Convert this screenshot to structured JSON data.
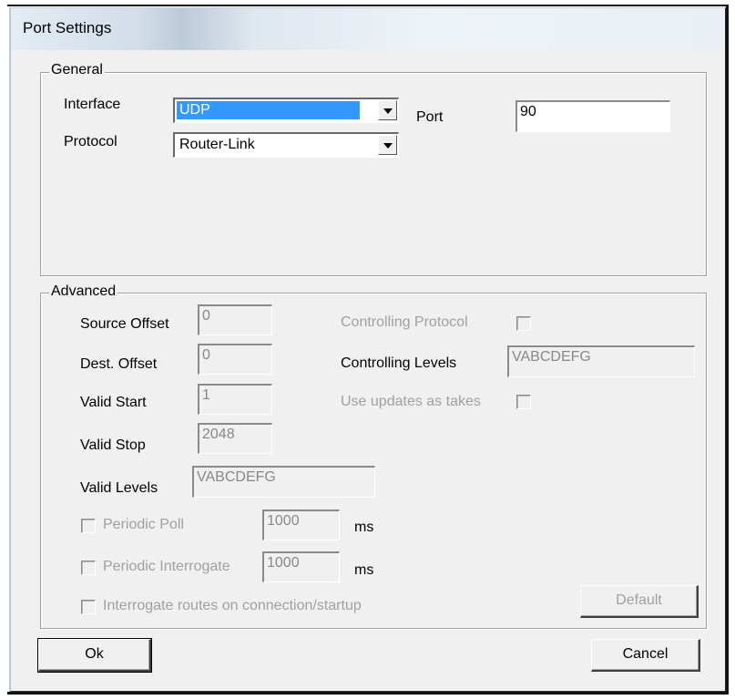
{
  "window": {
    "title": "Port Settings"
  },
  "general": {
    "legend": "General",
    "interface_label": "Interface",
    "interface_value": "UDP",
    "protocol_label": "Protocol",
    "protocol_value": "Router-Link",
    "port_label": "Port",
    "port_value": "90"
  },
  "advanced": {
    "legend": "Advanced",
    "source_offset_label": "Source Offset",
    "source_offset_value": "0",
    "dest_offset_label": "Dest. Offset",
    "dest_offset_value": "0",
    "valid_start_label": "Valid Start",
    "valid_start_value": "1",
    "valid_stop_label": "Valid Stop",
    "valid_stop_value": "2048",
    "valid_levels_label": "Valid Levels",
    "valid_levels_value": "VABCDEFG",
    "controlling_protocol_label": "Controlling Protocol",
    "controlling_levels_label": "Controlling Levels",
    "controlling_levels_value": "VABCDEFG",
    "use_updates_label": "Use updates as takes",
    "periodic_poll_label": "Periodic Poll",
    "periodic_poll_value": "1000",
    "periodic_poll_unit": "ms",
    "periodic_interrogate_label": "Periodic Interrogate",
    "periodic_interrogate_value": "1000",
    "periodic_interrogate_unit": "ms",
    "interrogate_routes_label": "Interrogate routes on connection/startup",
    "default_button": "Default"
  },
  "footer": {
    "ok_button": "Ok",
    "cancel_button": "Cancel"
  },
  "colors": {
    "selection": "#3399ff",
    "dialog_bg": "#f0f0f0",
    "disabled_text": "#a0a0a0"
  }
}
